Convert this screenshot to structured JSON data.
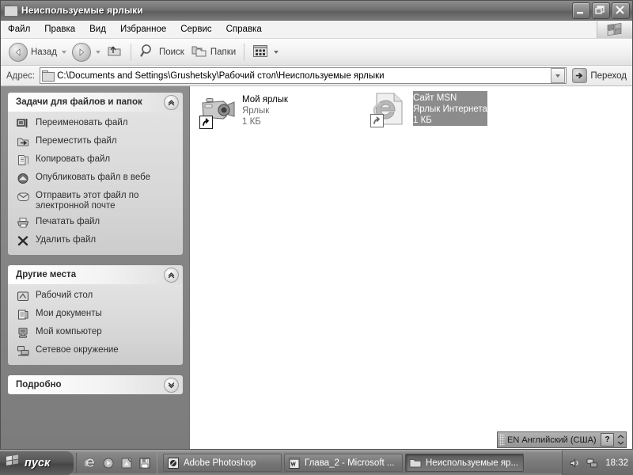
{
  "window": {
    "title": "Неиспользуемые ярлыки",
    "title_icon": "folder-icon",
    "buttons": {
      "minimize": "minimize-icon",
      "restore": "restore-icon",
      "close": "close-icon"
    }
  },
  "menubar": {
    "items": [
      {
        "label": "Файл"
      },
      {
        "label": "Правка"
      },
      {
        "label": "Вид"
      },
      {
        "label": "Избранное"
      },
      {
        "label": "Сервис"
      },
      {
        "label": "Справка"
      }
    ],
    "logo": "windows-flag-icon"
  },
  "toolbar": {
    "back_label": "Назад",
    "forward_label": "",
    "up_label": "",
    "search_label": "Поиск",
    "folders_label": "Папки",
    "views_label": ""
  },
  "addressbar": {
    "label": "Адрес:",
    "value": "C:\\Documents and Settings\\Grushetsky\\Рабочий стол\\Неиспользуемые ярлыки",
    "go_label": "Переход"
  },
  "sidebar": {
    "panels": [
      {
        "title": "Задачи для файлов и папок",
        "collapse_state": "expanded",
        "items": [
          {
            "label": "Переименовать файл",
            "icon": "rename-icon"
          },
          {
            "label": "Переместить файл",
            "icon": "move-icon"
          },
          {
            "label": "Копировать файл",
            "icon": "copy-icon"
          },
          {
            "label": "Опубликовать файл в вебе",
            "icon": "publish-web-icon"
          },
          {
            "label": "Отправить этот файл по электронной почте",
            "icon": "email-icon"
          },
          {
            "label": "Печатать файл",
            "icon": "print-icon"
          },
          {
            "label": "Удалить файл",
            "icon": "delete-icon"
          }
        ]
      },
      {
        "title": "Другие места",
        "collapse_state": "expanded",
        "items": [
          {
            "label": "Рабочий стол",
            "icon": "desktop-icon"
          },
          {
            "label": "Мои документы",
            "icon": "my-documents-icon"
          },
          {
            "label": "Мой компьютер",
            "icon": "my-computer-icon"
          },
          {
            "label": "Сетевое окружение",
            "icon": "network-icon"
          }
        ]
      },
      {
        "title": "Подробно",
        "collapse_state": "collapsed",
        "items": []
      }
    ]
  },
  "files": [
    {
      "name": "Мой ярлык",
      "type": "Ярлык",
      "size": "1 КБ",
      "icon": "camcorder-icon",
      "selected": false
    },
    {
      "name": "Сайт MSN",
      "type": "Ярлык Интернета",
      "size": "1 КБ",
      "icon": "internet-explorer-icon",
      "selected": true
    }
  ],
  "language_bar": {
    "text": "EN Английский (США)",
    "help_label": "?"
  },
  "taskbar": {
    "start_label": "пуск",
    "quick_launch": [
      {
        "icon": "internet-explorer-icon"
      },
      {
        "icon": "media-player-icon"
      },
      {
        "icon": "show-desktop-icon"
      },
      {
        "icon": "save-floppy-icon"
      }
    ],
    "tasks": [
      {
        "label": "Adobe Photoshop",
        "icon": "photoshop-icon",
        "active": false
      },
      {
        "label": "Глава_2 - Microsoft ...",
        "icon": "word-icon",
        "active": false
      },
      {
        "label": "Неиспользуемые яр...",
        "icon": "folder-icon",
        "active": true
      }
    ],
    "tray": [
      {
        "icon": "volume-icon"
      },
      {
        "icon": "network-connection-icon"
      }
    ],
    "clock": "18:32"
  },
  "colors": {
    "desktop": "#808080",
    "selection": "#8c8c8c",
    "file_area": "#ffffff",
    "sidebar": "#868686"
  }
}
